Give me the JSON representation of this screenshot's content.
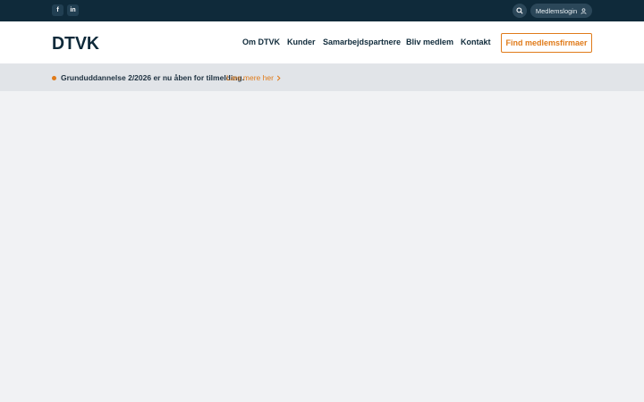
{
  "topbar": {
    "social": [
      {
        "icon": "facebook-icon",
        "glyph": "f"
      },
      {
        "icon": "linkedin-icon",
        "glyph": "in"
      }
    ],
    "search_icon": "search-icon",
    "login_label": "Medlemslogin",
    "login_icon": "user-icon"
  },
  "header": {
    "logo_text": "DTVK",
    "nav": [
      "Om DTVK",
      "Kunder",
      "Samarbejdspartnere",
      "Bliv medlem",
      "Kontakt"
    ],
    "cta_label": "Find medlemsfirmaer"
  },
  "announcement": {
    "text": "Grunduddannelse 2/2026 er nu åben for tilmelding.",
    "link_label": "Læs mere her"
  },
  "colors": {
    "topbar": "#0f2a3a",
    "accent": "#e07b1a",
    "background": "#f1f2f4"
  }
}
